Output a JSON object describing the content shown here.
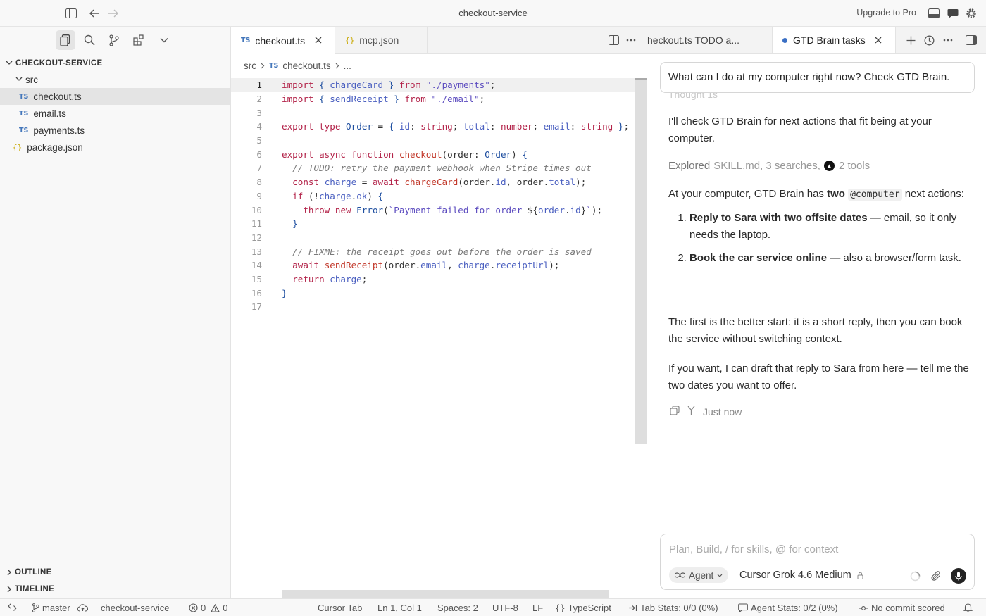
{
  "window": {
    "title": "checkout-service",
    "upgrade_label": "Upgrade to Pro"
  },
  "explorer": {
    "root": "CHECKOUT-SERVICE",
    "folder": "src",
    "files": [
      {
        "name": "checkout.ts",
        "badge": "TS"
      },
      {
        "name": "email.ts",
        "badge": "TS"
      },
      {
        "name": "payments.ts",
        "badge": "TS"
      }
    ],
    "root_file": {
      "name": "package.json",
      "badge": "{}"
    },
    "outline_label": "OUTLINE",
    "timeline_label": "TIMELINE"
  },
  "editor": {
    "tabs": [
      {
        "badge": "TS",
        "label": "checkout.ts"
      },
      {
        "badge": "{}",
        "label": "mcp.json"
      }
    ],
    "breadcrumb": {
      "folder": "src",
      "badge": "TS",
      "file": "checkout.ts",
      "more": "..."
    },
    "line_numbers": [
      "1",
      "2",
      "3",
      "4",
      "5",
      "6",
      "7",
      "8",
      "9",
      "10",
      "11",
      "12",
      "13",
      "14",
      "15",
      "16",
      "17"
    ]
  },
  "chat": {
    "tabs": [
      {
        "label": "heckout.ts TODO a..."
      },
      {
        "label": "GTD Brain tasks"
      }
    ],
    "query": "What can I do at my computer right now? Check GTD Brain.",
    "thought": "Thought 1s",
    "intro": "I'll check GTD Brain for next actions that fit being at your computer.",
    "explored_label": "Explored",
    "explored_detail": "SKILL.md, 3 searches,",
    "explored_tools": "2 tools",
    "answer_prefix": "At your computer, GTD Brain has",
    "answer_bold": "two",
    "answer_code": "@computer",
    "answer_suffix": "next actions:",
    "items": [
      {
        "bold": "Reply to Sara with two offsite dates",
        "rest": " — email, so it only needs the laptop."
      },
      {
        "bold": "Book the car service online",
        "rest": " — also a browser/form task."
      }
    ],
    "para2": "The first is the better start: it is a short reply, then you can book the service without switching context.",
    "para3": "If you want, I can draft that reply to Sara from here — tell me the two dates you want to offer.",
    "timestamp": "Just now",
    "composer_placeholder": "Plan, Build, / for skills, @ for context",
    "mode": "Agent",
    "model": "Cursor Grok 4.6 Medium"
  },
  "status": {
    "branch": "master",
    "project": "checkout-service",
    "errors": "0",
    "warnings": "0",
    "cursor_tab": "Cursor Tab",
    "position": "Ln 1, Col 1",
    "spaces": "Spaces: 2",
    "encoding": "UTF-8",
    "eol": "LF",
    "language": "TypeScript",
    "tab_stats": "Tab Stats: 0/0 (0%)",
    "agent_stats": "Agent Stats: 0/2 (0%)",
    "commit": "No commit scored"
  }
}
